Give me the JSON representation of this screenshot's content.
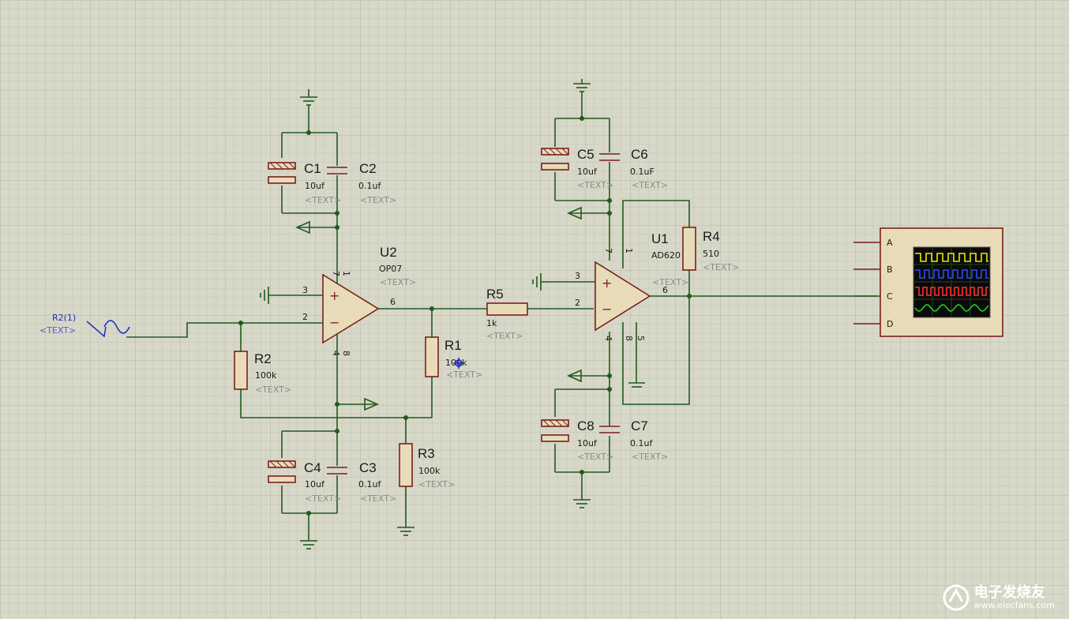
{
  "schematic": {
    "components": {
      "C1": {
        "ref": "C1",
        "value": "10uf",
        "text": "<TEXT>"
      },
      "C2": {
        "ref": "C2",
        "value": "0.1uf",
        "text": "<TEXT>"
      },
      "C3": {
        "ref": "C3",
        "value": "0.1uf",
        "text": "<TEXT>"
      },
      "C4": {
        "ref": "C4",
        "value": "10uf",
        "text": "<TEXT>"
      },
      "C5": {
        "ref": "C5",
        "value": "10uf",
        "text": "<TEXT>"
      },
      "C6": {
        "ref": "C6",
        "value": "0.1uF",
        "text": "<TEXT>"
      },
      "C7": {
        "ref": "C7",
        "value": "0.1uf",
        "text": "<TEXT>"
      },
      "C8": {
        "ref": "C8",
        "value": "10uf",
        "text": "<TEXT>"
      },
      "R1": {
        "ref": "R1",
        "value": "100k",
        "text": "<TEXT>"
      },
      "R2": {
        "ref": "R2",
        "value": "100k",
        "text": "<TEXT>"
      },
      "R3": {
        "ref": "R3",
        "value": "100k",
        "text": "<TEXT>"
      },
      "R4": {
        "ref": "R4",
        "value": "510",
        "text": "<TEXT>"
      },
      "R5": {
        "ref": "R5",
        "value": "1k",
        "text": "<TEXT>"
      },
      "U1": {
        "ref": "U1",
        "value": "AD620",
        "text": "<TEXT>"
      },
      "U2": {
        "ref": "U2",
        "value": "OP07",
        "text": "<TEXT>"
      }
    },
    "generator": {
      "ref": "R2(1)",
      "text": "<TEXT>"
    },
    "u2_pins": {
      "p3": "3",
      "p2": "2",
      "p6": "6",
      "p7": "7",
      "p1": "1",
      "p4": "4",
      "p8": "8"
    },
    "u1_pins": {
      "p3": "3",
      "p2": "2",
      "p6": "6",
      "p7": "7",
      "p1": "1",
      "p4": "4",
      "p8": "8",
      "p5": "5"
    },
    "scope_channels": [
      "A",
      "B",
      "C",
      "D"
    ],
    "scope_trace_colors": [
      "#e8e800",
      "#2a4cff",
      "#ff3030",
      "#20d020"
    ],
    "watermark": {
      "cn": "电子发烧友",
      "url": "www.elecfans.com"
    }
  }
}
